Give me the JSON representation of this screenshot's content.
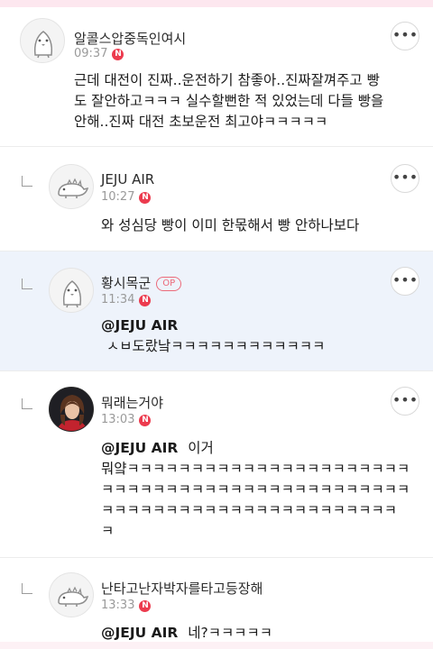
{
  "comments": [
    {
      "author": "알콜스압중독인여시",
      "time": "09:37",
      "new_badge": "N",
      "body": "근데 대전이 진짜..운전하기 참좋아..진짜잘껴주고 빵도 잘안하고ㅋㅋㅋ 실수할뻔한 적 있었는데 다들 빵을 안해..진짜 대전 초보운전 최고야ㅋㅋㅋㅋㅋ",
      "body_lines": [
        "근데 대전이 진짜..운전하기 참좋아..진짜잘껴주고 빵",
        "도 잘안하고ㅋㅋㅋ 실수할뻔한 적 있었는데 다들 빵을",
        "안해..진짜 대전 초보운전 최고야ㅋㅋㅋㅋㅋ"
      ]
    },
    {
      "author": "JEJU AIR",
      "time": "10:27",
      "new_badge": "N",
      "body_lines": [
        "와 성심당 빵이 이미 한몫해서 빵 안하나보다"
      ]
    },
    {
      "author": "황시목군",
      "op_label": "OP",
      "time": "11:34",
      "new_badge": "N",
      "mention": "@JEJU AIR",
      "body_lines": [
        "ㅅㅂ도랐낰ㅋㅋㅋㅋㅋㅋㅋㅋㅋㅋㅋㅋ"
      ]
    },
    {
      "author": "뭐래는거야",
      "time": "13:03",
      "new_badge": "N",
      "mention": "@JEJU AIR",
      "mention_tail": "이거",
      "body_lines": [
        "뭐얔ㅋㅋㅋㅋㅋㅋㅋㅋㅋㅋㅋㅋㅋㅋㅋㅋㅋㅋㅋㅋㅋㅋ",
        "ㅋㅋㅋㅋㅋㅋㅋㅋㅋㅋㅋㅋㅋㅋㅋㅋㅋㅋㅋㅋㅋㅋㅋㅋ",
        "ㅋㅋㅋㅋㅋㅋㅋㅋㅋㅋㅋㅋㅋㅋㅋㅋㅋㅋㅋㅋㅋㅋㅋ",
        "ㅋ"
      ]
    },
    {
      "author": "난타고난자박자를타고등장해",
      "time": "13:33",
      "new_badge": "N",
      "mention": "@JEJU AIR",
      "mention_tail": "네?ㅋㅋㅋㅋㅋ"
    }
  ],
  "more_button_glyph": "•••",
  "avatar_icons": [
    "penguin-icon",
    "dinosaur-icon",
    "penguin-icon",
    "profile-photo",
    "dinosaur-icon"
  ],
  "colors": {
    "op_background": "#eef3fb",
    "new_badge": "#ec3b4e",
    "op_badge": "#ec6a7a",
    "top_strip": "#fde7ef"
  }
}
